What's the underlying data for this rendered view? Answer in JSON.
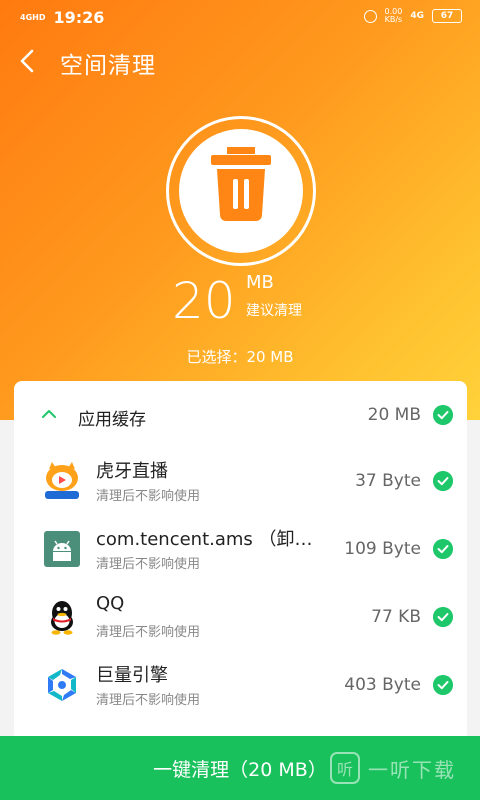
{
  "status_bar": {
    "network": "4GHD",
    "network2": "4G",
    "time": "19:26",
    "speed_value": "0.00",
    "speed_unit": "KB/s",
    "battery": "67"
  },
  "header": {
    "title": "空间清理"
  },
  "summary": {
    "size_value": "20",
    "size_unit": "MB",
    "size_hint": "建议清理",
    "selected_text": "已选择：20 MB"
  },
  "group": {
    "label": "应用缓存",
    "size": "20 MB"
  },
  "apps": [
    {
      "name": "虎牙直播",
      "subtitle": "清理后不影响使用",
      "size": "37 Byte",
      "icon": "huya-icon"
    },
    {
      "name": "com.tencent.ams （卸…",
      "subtitle": "清理后不影响使用",
      "size": "109 Byte",
      "icon": "android-icon"
    },
    {
      "name": "QQ",
      "subtitle": "清理后不影响使用",
      "size": "77 KB",
      "icon": "qq-icon"
    },
    {
      "name": "巨量引擎",
      "subtitle": "清理后不影响使用",
      "size": "403 Byte",
      "icon": "juliang-icon"
    }
  ],
  "action": {
    "clean_label": "一键清理（20 MB）"
  },
  "watermark": {
    "box": "听",
    "text": "一听下载"
  },
  "colors": {
    "accent_green": "#19c15c",
    "hero_orange": "#ff8a18",
    "hero_yellow": "#ffd23a"
  }
}
